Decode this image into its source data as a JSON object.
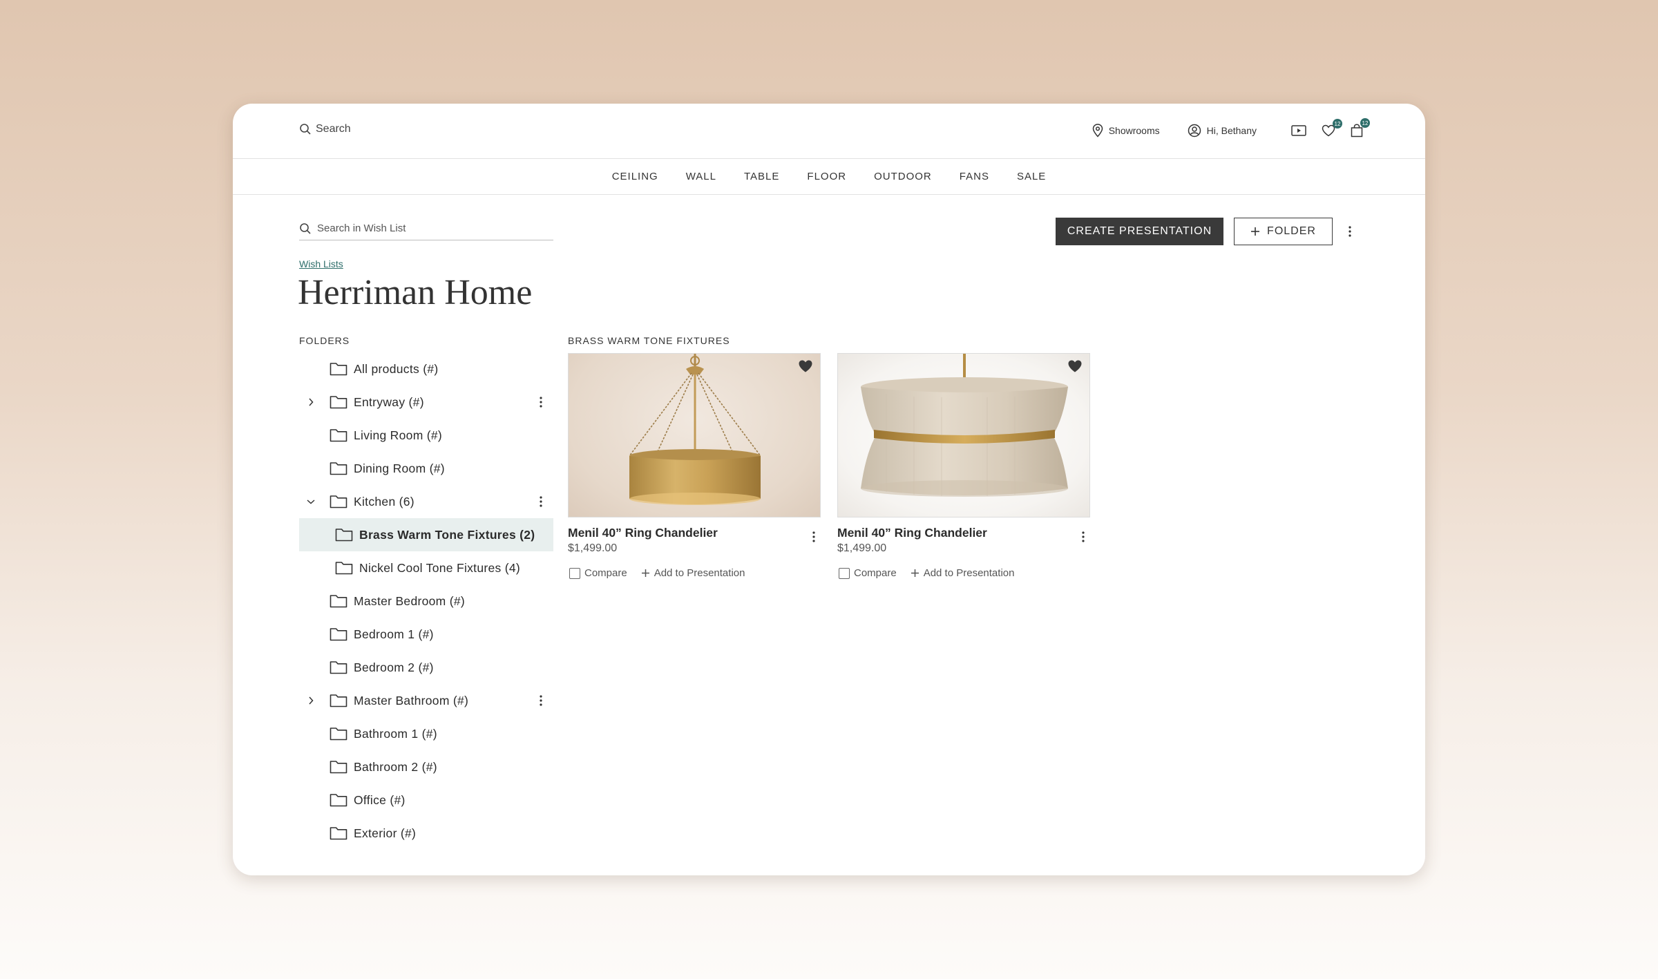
{
  "header": {
    "search_label": "Search",
    "showrooms_label": "Showrooms",
    "greeting": "Hi, Bethany",
    "wishlist_count": "12",
    "cart_count": "12"
  },
  "nav": [
    "CEILING",
    "WALL",
    "TABLE",
    "FLOOR",
    "OUTDOOR",
    "FANS",
    "SALE"
  ],
  "wishlist_search": {
    "placeholder": "Search in Wish List"
  },
  "actions": {
    "create_presentation": "CREATE PRESENTATION",
    "folder": "FOLDER"
  },
  "breadcrumb": "Wish Lists",
  "page_title": "Herriman Home",
  "folders": {
    "label": "FOLDERS",
    "items": [
      {
        "label": "All products (#)"
      },
      {
        "label": "Entryway (#)"
      },
      {
        "label": "Living Room (#)"
      },
      {
        "label": "Dining Room (#)"
      },
      {
        "label": "Kitchen (6)"
      },
      {
        "label": "Brass Warm Tone Fixtures (2)"
      },
      {
        "label": "Nickel Cool Tone Fixtures (4)"
      },
      {
        "label": "Master Bedroom (#)"
      },
      {
        "label": "Bedroom 1 (#)"
      },
      {
        "label": "Bedroom 2 (#)"
      },
      {
        "label": "Master Bathroom (#)"
      },
      {
        "label": "Bathroom 1 (#)"
      },
      {
        "label": "Bathroom 2 (#)"
      },
      {
        "label": "Office (#)"
      },
      {
        "label": "Exterior (#)"
      }
    ]
  },
  "section_title": "BRASS WARM TONE FIXTURES",
  "products": [
    {
      "name": "Menil 40” Ring Chandelier",
      "price": "$1,499.00",
      "compare_label": "Compare",
      "add_label": "Add to Presentation"
    },
    {
      "name": "Menil 40” Ring Chandelier",
      "price": "$1,499.00",
      "compare_label": "Compare",
      "add_label": "Add to Presentation"
    }
  ],
  "colors": {
    "accent": "#2e6e6a",
    "dark_button": "#3a3a3a",
    "selected_row": "#e8efee"
  }
}
